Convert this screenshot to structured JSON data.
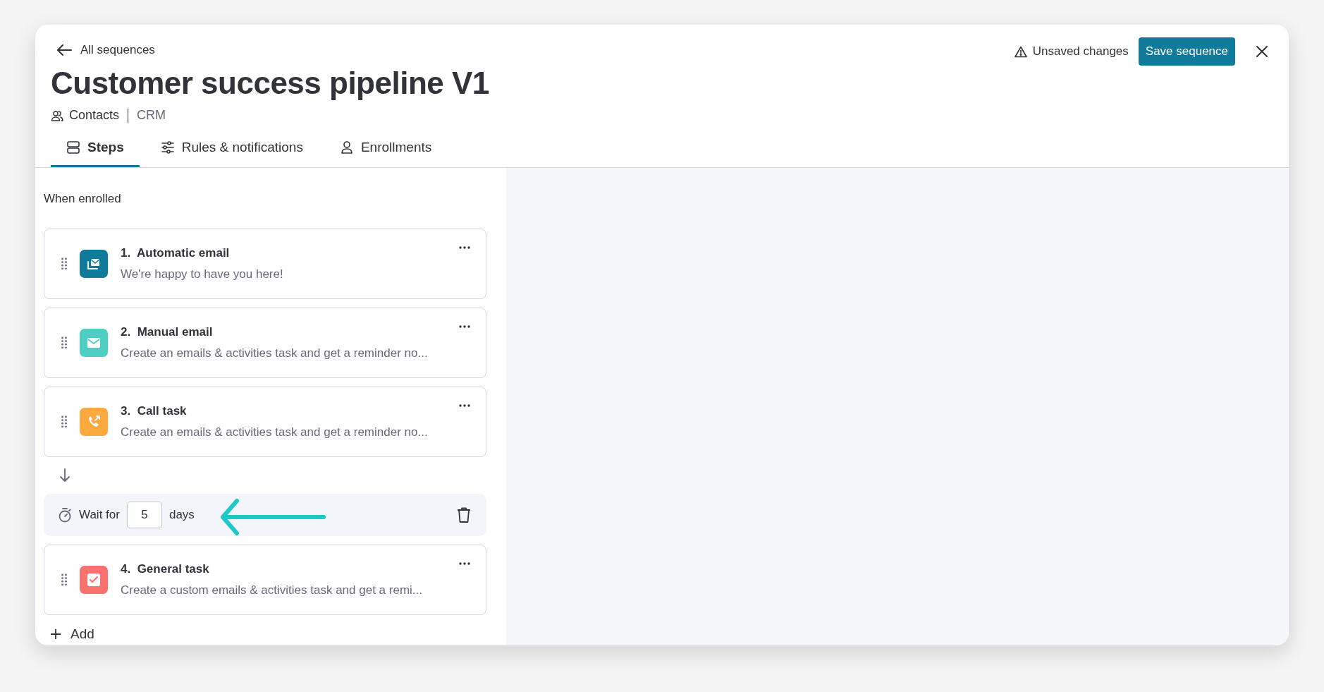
{
  "back_link": "All sequences",
  "title": "Customer success pipeline V1",
  "object": {
    "label": "Contacts",
    "app": "CRM"
  },
  "status": "Unsaved changes",
  "save_button": "Save sequence",
  "tabs": [
    {
      "label": "Steps",
      "kind": "steps",
      "selected": true
    },
    {
      "label": "Rules & notifications",
      "kind": "rules",
      "selected": false
    },
    {
      "label": "Enrollments",
      "kind": "enrollments",
      "selected": false
    }
  ],
  "trigger": "When enrolled",
  "steps": [
    {
      "kind": "automatic_email",
      "number": "1.",
      "title": "Automatic email",
      "description": "We're happy to have you here!",
      "color": "#0f7a99"
    },
    {
      "kind": "manual_email",
      "number": "2.",
      "title": "Manual email",
      "description": "Create an emails & activities task and get a reminder no...",
      "color": "#4fcfc4"
    },
    {
      "kind": "call_task",
      "number": "3.",
      "title": "Call task",
      "description": "Create an emails & activities task and get a reminder no...",
      "color": "#fca93d"
    },
    {
      "kind": "wait",
      "label": "Wait for",
      "value": "5",
      "unit": "days"
    },
    {
      "kind": "general_task",
      "number": "4.",
      "title": "General task",
      "description": "Create a custom emails & activities task and get a remi...",
      "color": "#fb7170"
    }
  ],
  "add_button": "Add"
}
